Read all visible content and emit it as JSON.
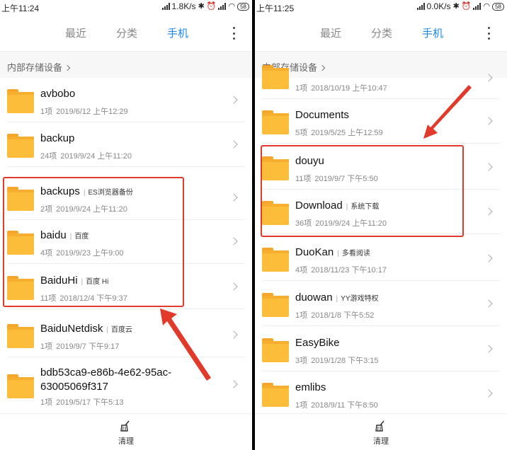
{
  "left": {
    "status": {
      "time": "上午11:24",
      "speed": "1.8K/s",
      "battery": "58"
    },
    "tabs": [
      "最近",
      "分类",
      "手机"
    ],
    "active_tab": 2,
    "breadcrumb": "内部存储设备",
    "files": [
      {
        "name": "avbobo",
        "tag": "",
        "count": "1项",
        "date": "2019/6/12 上午12:29"
      },
      {
        "name": "backup",
        "tag": "",
        "count": "24项",
        "date": "2019/9/24 上午11:20"
      },
      {
        "name": "backups",
        "tag": "ES浏览器备份",
        "count": "2项",
        "date": "2019/9/24 上午11:20"
      },
      {
        "name": "baidu",
        "tag": "百度",
        "count": "4项",
        "date": "2019/9/23 上午9:00"
      },
      {
        "name": "BaiduHi",
        "tag": "百度 Hi",
        "count": "11项",
        "date": "2018/12/4 下午9:37"
      },
      {
        "name": "BaiduNetdisk",
        "tag": "百度云",
        "count": "1项",
        "date": "2019/9/7 下午9:17"
      },
      {
        "name": "bdb53ca9-e86b-4e62-95ac-",
        "name2": "63005069f317",
        "tag": "",
        "count": "1项",
        "date": "2019/5/17 下午5:13"
      }
    ],
    "bottom_label": "清理"
  },
  "right": {
    "status": {
      "time": "上午11:25",
      "speed": "0.0K/s",
      "battery": "58"
    },
    "tabs": [
      "最近",
      "分类",
      "手机"
    ],
    "active_tab": 2,
    "breadcrumb": "内部存储设备",
    "partial_meta": {
      "count": "1项",
      "date": "2018/10/19 上午10:47"
    },
    "files": [
      {
        "name": "Documents",
        "tag": "",
        "count": "5项",
        "date": "2019/5/25 上午12:59"
      },
      {
        "name": "douyu",
        "tag": "",
        "count": "11项",
        "date": "2019/9/7 下午5:50"
      },
      {
        "name": "Download",
        "tag": "系统下载",
        "count": "36项",
        "date": "2019/9/24 上午11:20"
      },
      {
        "name": "DuoKan",
        "tag": "多看阅读",
        "count": "4项",
        "date": "2018/11/23 下午10:17"
      },
      {
        "name": "duowan",
        "tag": "YY游戏特权",
        "count": "1项",
        "date": "2018/1/8 下午5:52"
      },
      {
        "name": "EasyBike",
        "tag": "",
        "count": "3项",
        "date": "2019/1/28 下午3:15"
      },
      {
        "name": "emlibs",
        "tag": "",
        "count": "1项",
        "date": "2018/9/11 下午8:50"
      }
    ],
    "bottom_label": "清理"
  },
  "colors": {
    "accent": "#1e88e5",
    "folder": "#fbbd3a",
    "highlight": "#e23a2a"
  }
}
